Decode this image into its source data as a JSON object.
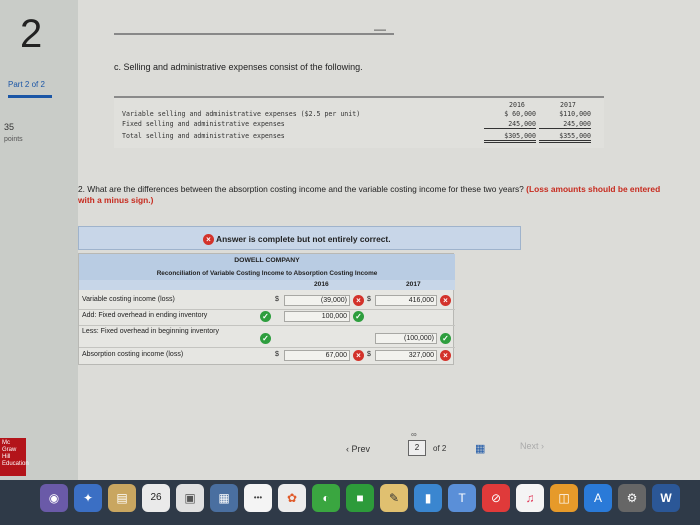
{
  "sidebar": {
    "question_number": "2",
    "part": "Part 2 of 2",
    "points": "35",
    "points_label": "points",
    "logo_text": "Mc Graw Hill Education"
  },
  "header": {
    "minus": "—"
  },
  "part_c": {
    "prompt": "c. Selling and administrative expenses consist of the following.",
    "years": [
      "2016",
      "2017"
    ],
    "rows": [
      {
        "label": "Variable selling and administrative expenses ($2.5 per unit)",
        "v2016": "$ 60,000",
        "v2017": "$110,000"
      },
      {
        "label": "Fixed selling and administrative expenses",
        "v2016": "245,000",
        "v2017": "245,000"
      },
      {
        "label": "Total selling and administrative expenses",
        "v2016": "$305,000",
        "v2017": "$355,000"
      }
    ]
  },
  "question2": {
    "text": "2. What are the differences between the absorption costing income and the variable costing income for these two years?",
    "note": "(Loss amounts should be entered with a minus sign.)"
  },
  "banner": {
    "text": "Answer is complete but not entirely correct."
  },
  "table": {
    "company": "DOWELL COMPANY",
    "title": "Reconciliation of Variable Costing Income to Absorption Costing Income",
    "year1": "2016",
    "year2": "2017",
    "rows": [
      {
        "label": "Variable costing income (loss)",
        "c1": "$",
        "v1": "(39,000)",
        "s1": "bad",
        "c2": "$",
        "v2": "416,000",
        "s2": "bad"
      },
      {
        "label": "Add: Fixed overhead in ending inventory",
        "c1": "",
        "v1": "100,000",
        "s1": "good",
        "c2": "",
        "v2": "",
        "s2": ""
      },
      {
        "label": "Less: Fixed overhead in beginning inventory",
        "c1": "",
        "v1": "",
        "s1": "",
        "c2": "",
        "v2": "(100,000)",
        "s2": "good"
      },
      {
        "label": "Absorption costing income (loss)",
        "c1": "$",
        "v1": "67,000",
        "s1": "bad",
        "c2": "$",
        "v2": "327,000",
        "s2": "bad"
      }
    ]
  },
  "pager": {
    "prev": "Prev",
    "current": "2",
    "of": "of 2",
    "next": "Next"
  },
  "dock": {
    "calendar_day": "26",
    "word_label": "W"
  }
}
